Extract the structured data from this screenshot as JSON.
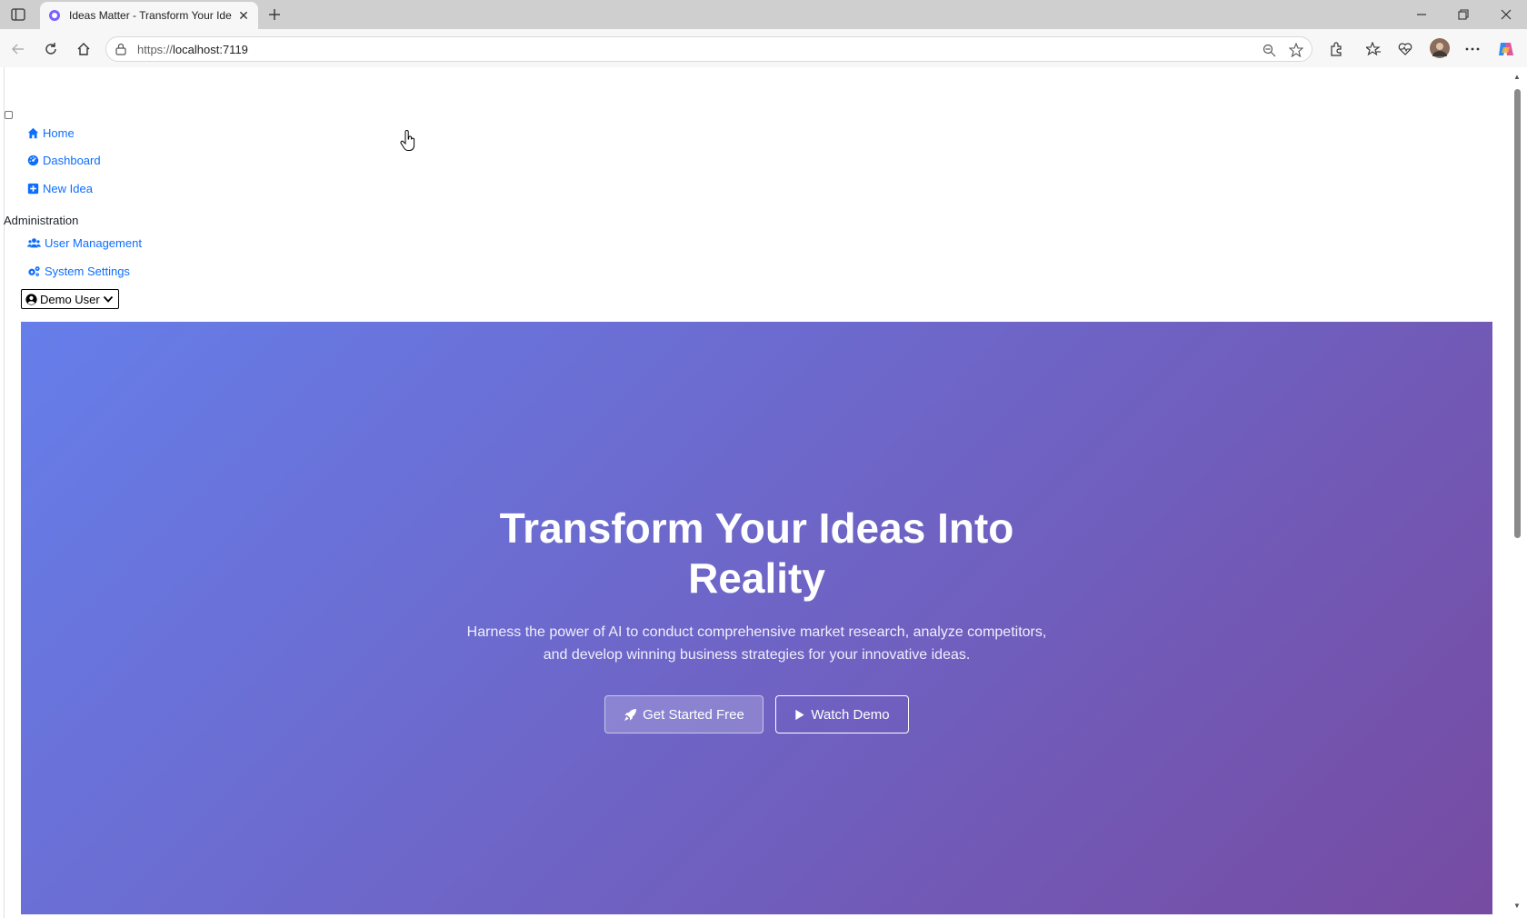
{
  "browser": {
    "tab_title": "Ideas Matter - Transform Your Ide",
    "url_scheme": "https://",
    "url_host": "localhost:7119"
  },
  "nav": {
    "items": [
      {
        "label": "Home",
        "icon": "home-icon"
      },
      {
        "label": "Dashboard",
        "icon": "dashboard-icon"
      },
      {
        "label": "New Idea",
        "icon": "plus-square-icon"
      }
    ],
    "admin_heading": "Administration",
    "admin_items": [
      {
        "label": "User Management",
        "icon": "users-icon"
      },
      {
        "label": "System Settings",
        "icon": "cogs-icon"
      }
    ],
    "user_menu_label": "Demo User"
  },
  "hero": {
    "title_line1": "Transform Your Ideas Into",
    "title_line2": "Reality",
    "subtitle_line1": "Harness the power of AI to conduct comprehensive market research, analyze competitors,",
    "subtitle_line2": "and develop winning business strategies for your innovative ideas.",
    "primary_button": "Get Started Free",
    "secondary_button": "Watch Demo",
    "gradient_start": "#667eea",
    "gradient_end": "#764ba2"
  },
  "colors": {
    "link": "#0d6efd",
    "text": "#212529"
  }
}
